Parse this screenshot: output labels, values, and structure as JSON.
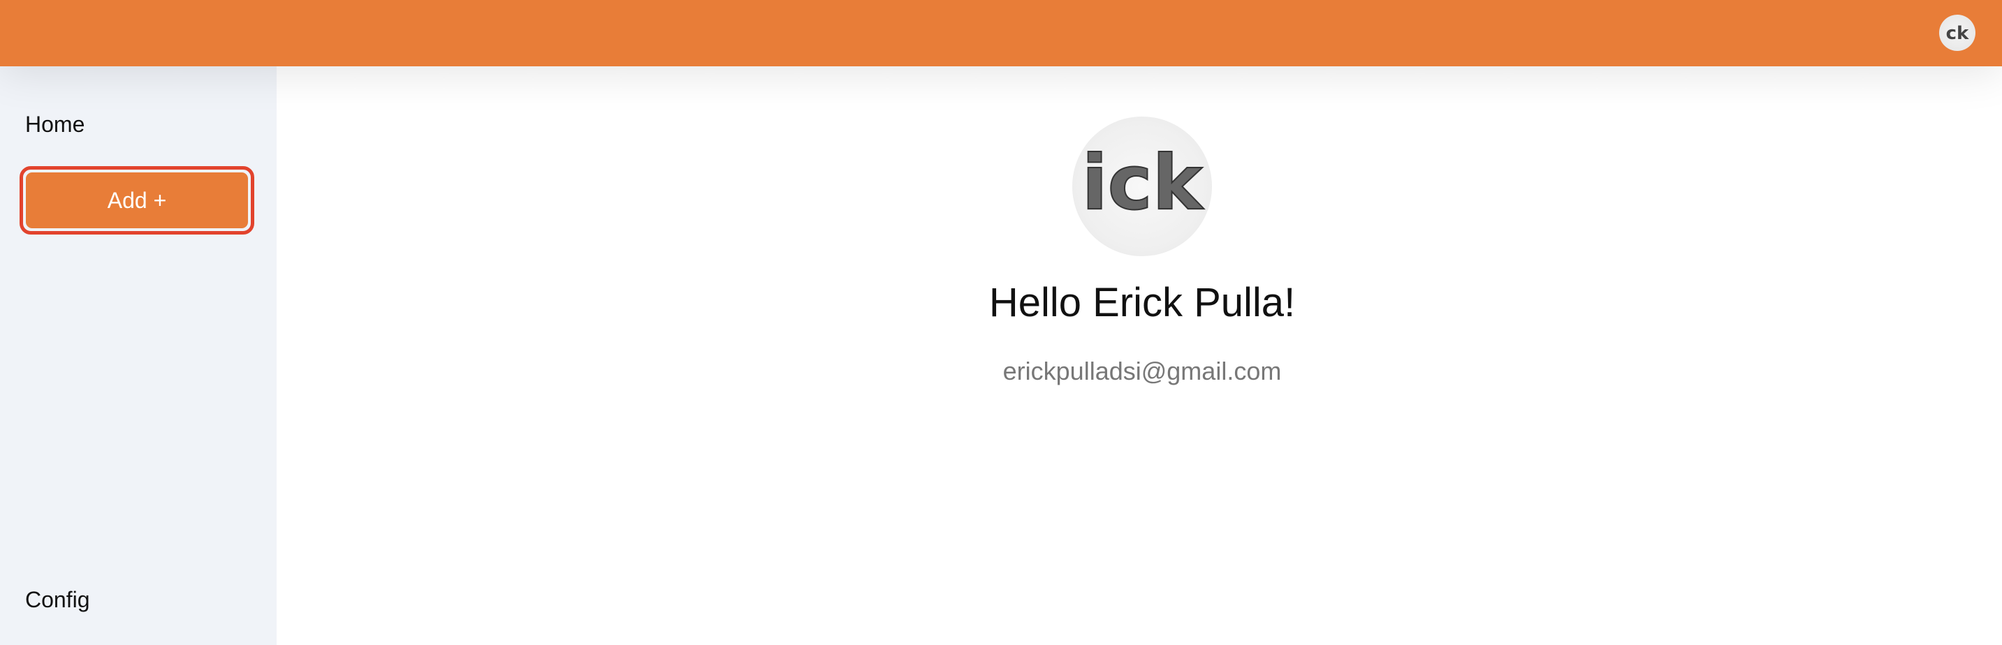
{
  "topbar": {
    "color": "#e87d38",
    "avatar_icon": "user-avatar-icon"
  },
  "sidebar": {
    "home_label": "Home",
    "add_button_label": "Add +",
    "config_label": "Config"
  },
  "profile": {
    "greeting": "Hello Erick Pulla!",
    "email": "erickpulladsi@gmail.com",
    "avatar_icon": "profile-avatar-icon"
  }
}
